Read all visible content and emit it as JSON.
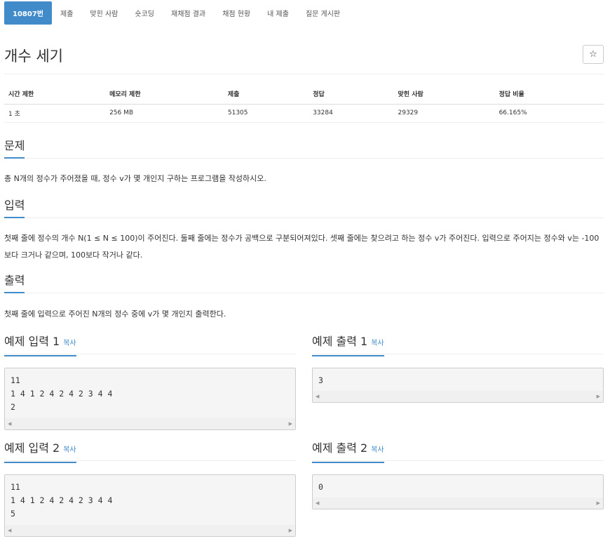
{
  "tabs": [
    {
      "label": "10807번",
      "active": true
    },
    {
      "label": "제출"
    },
    {
      "label": "맞힌 사람"
    },
    {
      "label": "숏코딩"
    },
    {
      "label": "재채점 결과"
    },
    {
      "label": "채점 현황"
    },
    {
      "label": "내 제출"
    },
    {
      "label": "질문 게시판"
    }
  ],
  "problem": {
    "title": "개수 세기",
    "star_icon": "☆"
  },
  "info": {
    "headers": [
      "시간 제한",
      "메모리 제한",
      "제출",
      "정답",
      "맞힌 사람",
      "정답 비율"
    ],
    "values": [
      "1 초",
      "256 MB",
      "51305",
      "33284",
      "29329",
      "66.165%"
    ]
  },
  "sections": {
    "description": {
      "title": "문제",
      "text": "총 N개의 정수가 주어졌을 때, 정수 v가 몇 개인지 구하는 프로그램을 작성하시오."
    },
    "input": {
      "title": "입력",
      "text": "첫째 줄에 정수의 개수 N(1 ≤ N ≤ 100)이 주어진다. 둘째 줄에는 정수가 공백으로 구분되어져있다. 셋째 줄에는 찾으려고 하는 정수 v가 주어진다. 입력으로 주어지는 정수와 v는 -100보다 크거나 같으며, 100보다 작거나 같다."
    },
    "output": {
      "title": "출력",
      "text": "첫째 줄에 입력으로 주어진 N개의 정수 중에 v가 몇 개인지 출력한다."
    }
  },
  "samples": {
    "copy_label": "복사",
    "input1": {
      "title": "예제 입력 1",
      "content": "11\n1 4 1 2 4 2 4 2 3 4 4\n2"
    },
    "output1": {
      "title": "예제 출력 1",
      "content": "3"
    },
    "input2": {
      "title": "예제 입력 2",
      "content": "11\n1 4 1 2 4 2 4 2 3 4 4\n5"
    },
    "output2": {
      "title": "예제 출력 2",
      "content": "0"
    }
  },
  "colors": {
    "accent": "#428bca",
    "code_bg": "#f5f5f5"
  }
}
